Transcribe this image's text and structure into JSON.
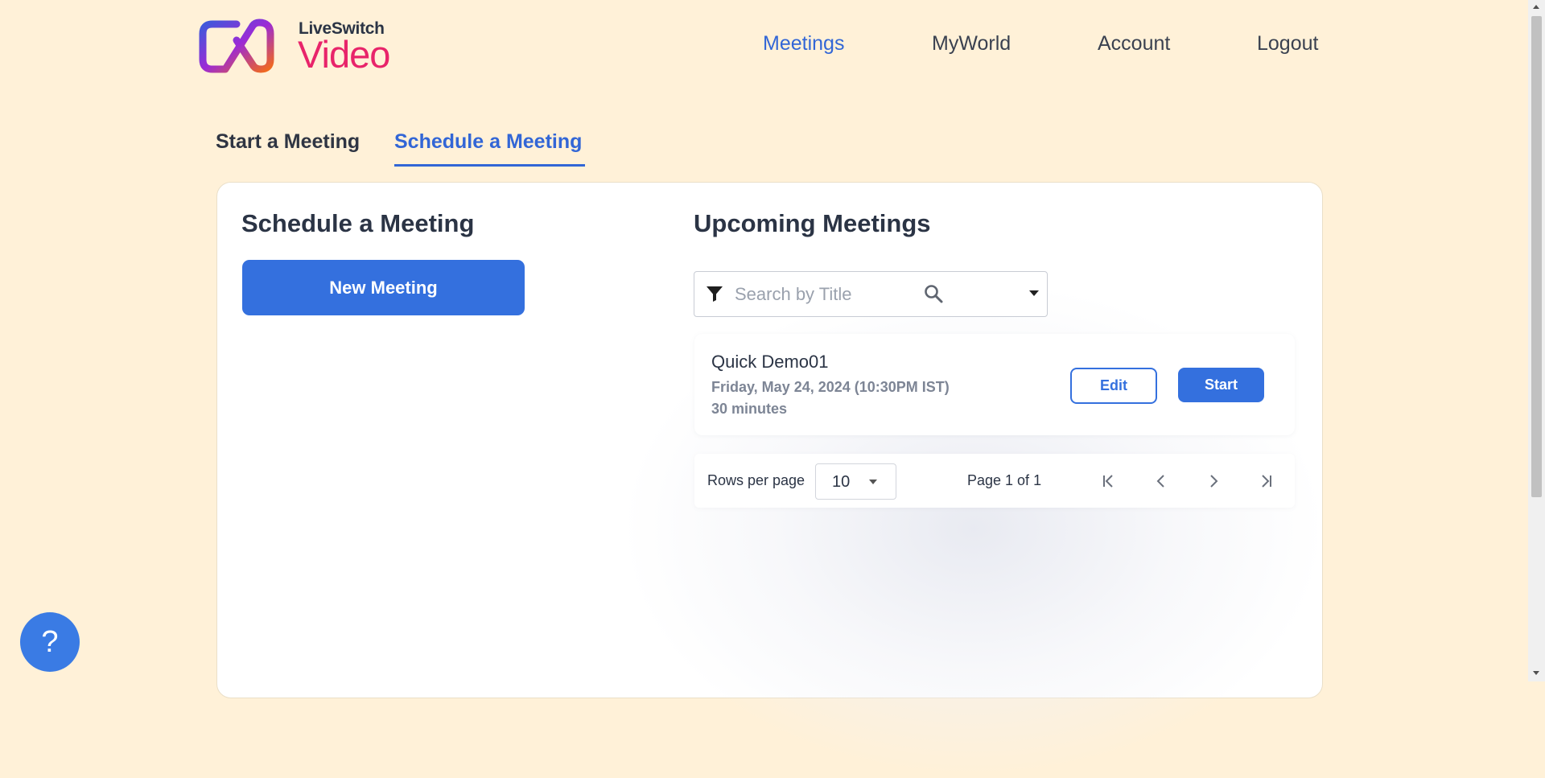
{
  "brand": {
    "top": "LiveSwitch",
    "main": "Video"
  },
  "nav": {
    "items": [
      {
        "label": "Meetings",
        "active": true
      },
      {
        "label": "MyWorld",
        "active": false
      },
      {
        "label": "Account",
        "active": false
      },
      {
        "label": "Logout",
        "active": false
      }
    ]
  },
  "tabs": [
    {
      "label": "Start a Meeting",
      "active": false
    },
    {
      "label": "Schedule a Meeting",
      "active": true
    }
  ],
  "schedule": {
    "heading": "Schedule a Meeting",
    "new_button": "New Meeting"
  },
  "upcoming": {
    "heading": "Upcoming Meetings",
    "search": {
      "placeholder": "Search by Title",
      "value": ""
    },
    "meetings": [
      {
        "title": "Quick Demo01",
        "date": "Friday, May 24, 2024 (10:30PM IST)",
        "duration": "30 minutes",
        "edit_label": "Edit",
        "start_label": "Start"
      }
    ],
    "pagination": {
      "rows_label": "Rows per page",
      "rows_value": "10",
      "page_info": "Page 1 of 1"
    }
  },
  "help": {
    "label": "?"
  },
  "colors": {
    "accent": "#3470de",
    "brand_pink": "#e8246a",
    "background": "#fff1d8"
  },
  "icons": [
    "logo-icon",
    "filter-icon",
    "search-icon",
    "chevron-down-icon",
    "first-page-icon",
    "prev-page-icon",
    "next-page-icon",
    "last-page-icon",
    "help-icon"
  ]
}
